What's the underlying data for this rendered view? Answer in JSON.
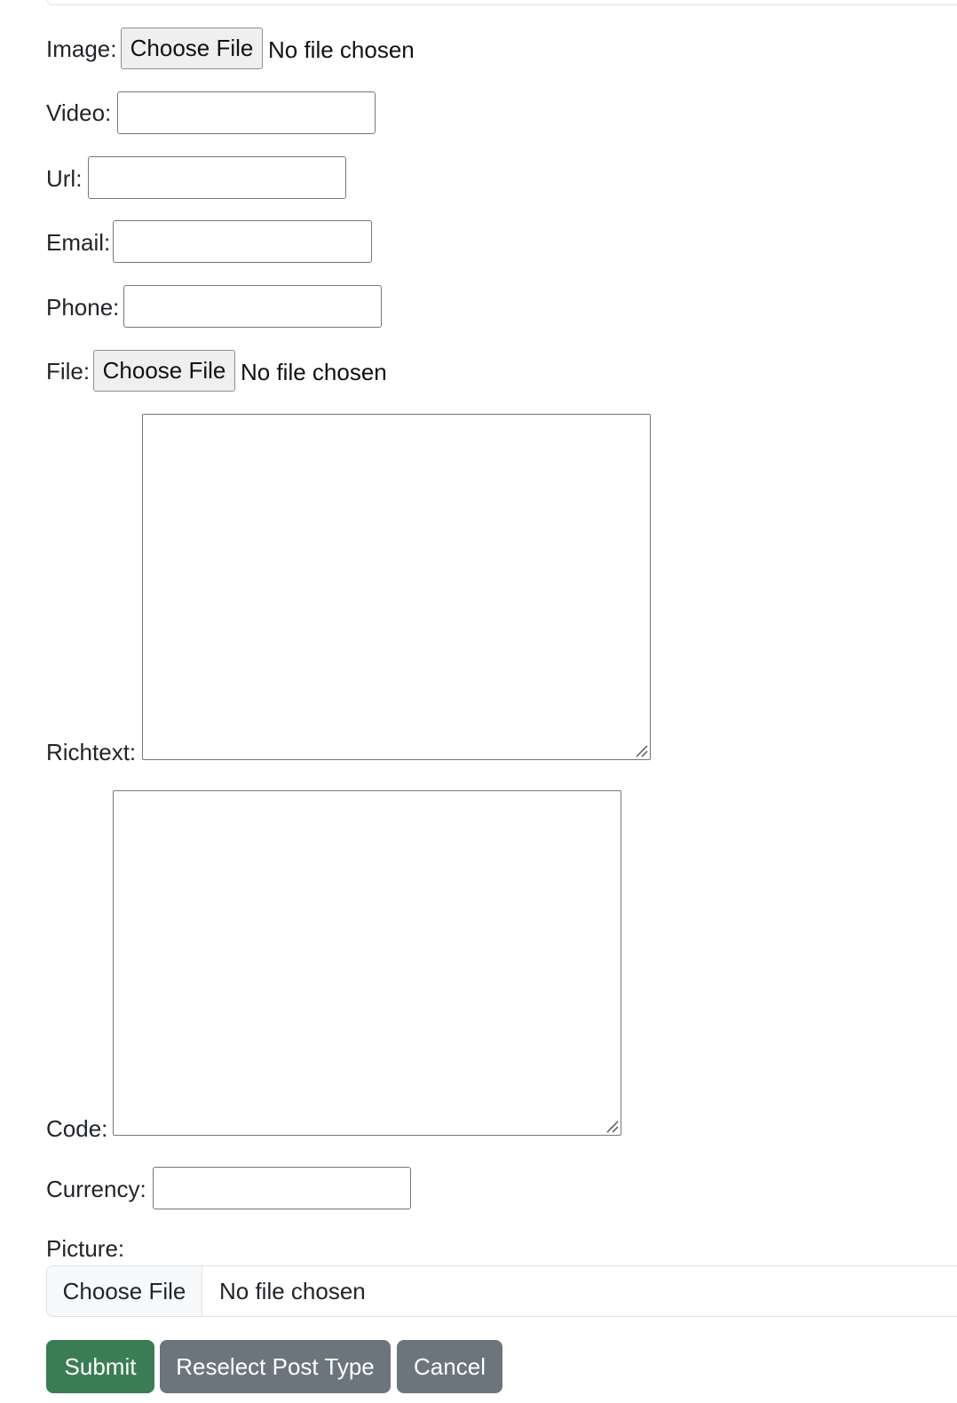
{
  "form": {
    "image": {
      "label": "Image:",
      "button": "Choose File",
      "status": "No file chosen"
    },
    "video": {
      "label": "Video:",
      "value": ""
    },
    "url": {
      "label": "Url:",
      "value": ""
    },
    "email": {
      "label": "Email:",
      "value": ""
    },
    "phone": {
      "label": "Phone:",
      "value": ""
    },
    "file": {
      "label": "File:",
      "button": "Choose File",
      "status": "No file chosen"
    },
    "richtext": {
      "label": "Richtext:",
      "value": ""
    },
    "code": {
      "label": "Code:",
      "value": ""
    },
    "currency": {
      "label": "Currency:",
      "value": ""
    },
    "picture": {
      "label": "Picture:",
      "button": "Choose File",
      "status": "No file chosen"
    }
  },
  "actions": {
    "submit": "Submit",
    "reselect": "Reselect Post Type",
    "cancel": "Cancel"
  },
  "colors": {
    "submit": "#3b7d55",
    "secondary": "#6c757d"
  }
}
